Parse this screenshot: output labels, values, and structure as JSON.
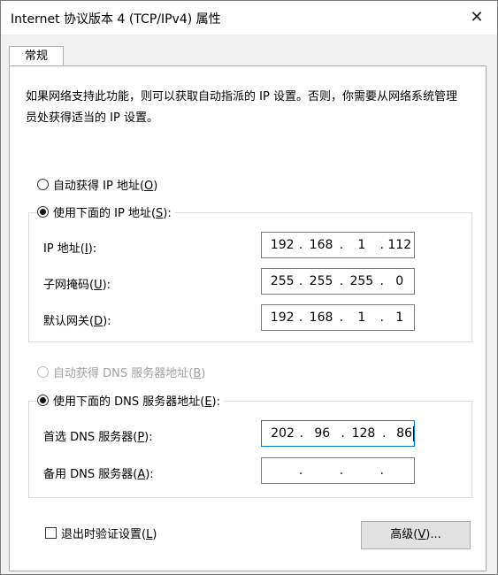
{
  "window": {
    "title": "Internet 协议版本 4 (TCP/IPv4) 属性",
    "close_glyph": "✕"
  },
  "tabs": [
    {
      "label": "常规",
      "selected": true
    }
  ],
  "description": "如果网络支持此功能，则可以获取自动指派的 IP 设置。否则，你需要从网络系统管理员处获得适当的 IP 设置。",
  "ip": {
    "auto_option": {
      "label_pre": "自动获得 IP 地址(",
      "mnemonic": "O",
      "label_post": ")",
      "checked": false
    },
    "manual_option": {
      "label_pre": "使用下面的 IP 地址(",
      "mnemonic": "S",
      "label_post": "):",
      "checked": true
    },
    "fields": [
      {
        "label_pre": "IP 地址(",
        "mnemonic": "I",
        "label_post": "):",
        "octets": [
          "192",
          "168",
          "1",
          "112"
        ]
      },
      {
        "label_pre": "子网掩码(",
        "mnemonic": "U",
        "label_post": "):",
        "octets": [
          "255",
          "255",
          "255",
          "0"
        ]
      },
      {
        "label_pre": "默认网关(",
        "mnemonic": "D",
        "label_post": "):",
        "octets": [
          "192",
          "168",
          "1",
          "1"
        ]
      }
    ]
  },
  "dns": {
    "auto_option": {
      "label_pre": "自动获得 DNS 服务器地址(",
      "mnemonic": "B",
      "label_post": ")",
      "checked": false,
      "disabled": true
    },
    "manual_option": {
      "label_pre": "使用下面的 DNS 服务器地址(",
      "mnemonic": "E",
      "label_post": "):",
      "checked": true
    },
    "fields": [
      {
        "label_pre": "首选 DNS 服务器(",
        "mnemonic": "P",
        "label_post": "):",
        "octets": [
          "202",
          "96",
          "128",
          "86"
        ]
      },
      {
        "label_pre": "备用 DNS 服务器(",
        "mnemonic": "A",
        "label_post": "):",
        "octets": [
          "",
          "",
          "",
          ""
        ]
      }
    ]
  },
  "validate_on_exit": {
    "label_pre": "退出时验证设置(",
    "mnemonic": "L",
    "label_post": ")",
    "checked": false
  },
  "advanced_button": {
    "label_pre": "高级(",
    "mnemonic": "V",
    "label_post": ")..."
  }
}
